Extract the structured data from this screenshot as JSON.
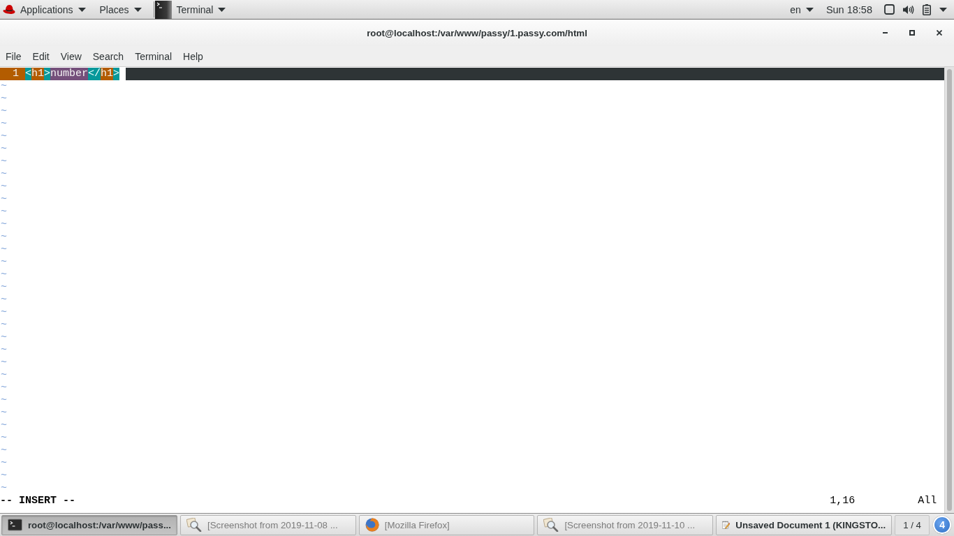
{
  "top_bar": {
    "menus": [
      {
        "label": "Applications",
        "kind": "applications"
      },
      {
        "label": "Places",
        "kind": "places"
      }
    ],
    "app_menu": {
      "label": "Terminal"
    },
    "keyboard_layout": "en",
    "clock": "Sun 18:58"
  },
  "window": {
    "title": "root@localhost:/var/www/passy/1.passy.com/html"
  },
  "menu_bar": [
    "File",
    "Edit",
    "View",
    "Search",
    "Terminal",
    "Help"
  ],
  "editor": {
    "lines": [
      {
        "number": "1",
        "current": true,
        "cursor": true,
        "tokens": [
          {
            "text": "<",
            "kind": "bracket"
          },
          {
            "text": "h1",
            "kind": "tag"
          },
          {
            "text": ">",
            "kind": "bracket"
          },
          {
            "text": "number",
            "kind": "text"
          },
          {
            "text": "</",
            "kind": "bracket"
          },
          {
            "text": "h1",
            "kind": "tag"
          },
          {
            "text": ">",
            "kind": "bracket"
          }
        ]
      }
    ],
    "filler_lines": [
      "~",
      "~",
      "~",
      "~",
      "~",
      "~",
      "~",
      "~",
      "~",
      "~",
      "~",
      "~",
      "~",
      "~",
      "~",
      "~",
      "~",
      "~",
      "~",
      "~",
      "~",
      "~",
      "~",
      "~",
      "~",
      "~",
      "~",
      "~",
      "~",
      "~",
      "~",
      "~",
      "~"
    ],
    "status_line": {
      "mode": "-- INSERT --",
      "ruler": "1,16",
      "position": "All"
    }
  },
  "taskbar": {
    "items": [
      {
        "label": "root@localhost:/var/www/pass...",
        "kind": "terminal",
        "selected": true,
        "minimized": false
      },
      {
        "label": "[Screenshot from 2019-11-08 ...",
        "kind": "image-viewer",
        "selected": false,
        "minimized": true
      },
      {
        "label": "[Mozilla Firefox]",
        "kind": "browser",
        "selected": false,
        "minimized": true
      },
      {
        "label": "[Screenshot from 2019-11-10 ...",
        "kind": "image-viewer",
        "selected": false,
        "minimized": true
      },
      {
        "label": "Unsaved Document 1 (KINGSTO...",
        "kind": "text-editor",
        "selected": false,
        "minimized": false
      }
    ],
    "workspace": "1 / 4",
    "notification_count": "4"
  }
}
